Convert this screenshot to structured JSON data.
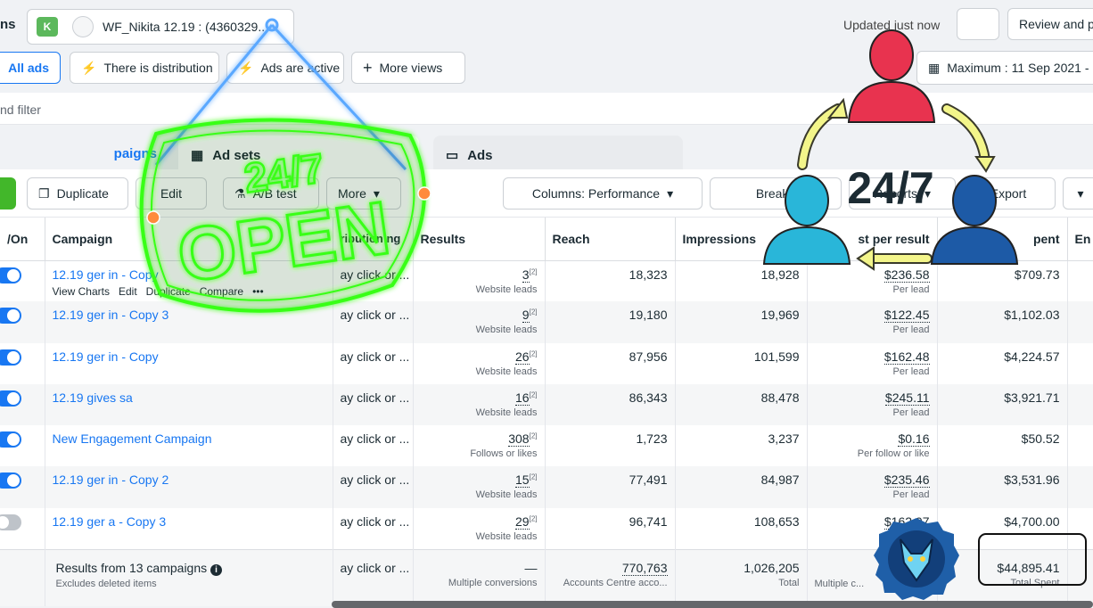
{
  "header": {
    "title_fragment": "ns",
    "account_badge": "K",
    "account_name": "WF_Nikita 12.19 : (4360329...",
    "updated": "Updated just now",
    "review": "Review and p"
  },
  "filters": {
    "all_ads": "All ads",
    "distribution": "There is distribution",
    "active": "Ads are active",
    "more_views": "More views",
    "date": "Maximum : 11 Sep 2021 -"
  },
  "filterbar": {
    "placeholder": "nd filter"
  },
  "tabs": {
    "campaigns": "paigns",
    "adsets": "Ad sets",
    "ads": "Ads"
  },
  "toolbar": {
    "duplicate": "Duplicate",
    "edit": "Edit",
    "ab_test": "A/B test",
    "more": "More",
    "columns": "Columns: Performance",
    "breakdown": "Breakd",
    "report": "Reports",
    "export": "Export"
  },
  "table": {
    "headers": {
      "toggle": "/On",
      "campaign": "Campaign",
      "attribution": "ribution ng",
      "results": "Results",
      "reach": "Reach",
      "impressions": "Impressions",
      "cost": "st per result",
      "spent": "pent",
      "end": "En"
    },
    "row_actions": [
      "View Charts",
      "Edit",
      "Duplicate",
      "Compare",
      "•••"
    ],
    "rows": [
      {
        "name": "12.19 ger in - Copy",
        "attr": "ay click or ...",
        "results": "3",
        "results_sub": "Website leads",
        "reach": "18,323",
        "impressions": "18,928",
        "cost": "$236.58",
        "cost_sub": "Per lead",
        "spent": "$709.73",
        "on": true
      },
      {
        "name": "12.19 ger in - Copy 3",
        "attr": "ay click or ...",
        "results": "9",
        "results_sub": "Website leads",
        "reach": "19,180",
        "impressions": "19,969",
        "cost": "$122.45",
        "cost_sub": "Per lead",
        "spent": "$1,102.03",
        "on": true
      },
      {
        "name": "12.19 ger in - Copy",
        "attr": "ay click or ...",
        "results": "26",
        "results_sub": "Website leads",
        "reach": "87,956",
        "impressions": "101,599",
        "cost": "$162.48",
        "cost_sub": "Per lead",
        "spent": "$4,224.57",
        "on": true
      },
      {
        "name": "12.19 gives sa",
        "attr": "ay click or ...",
        "results": "16",
        "results_sub": "Website leads",
        "reach": "86,343",
        "impressions": "88,478",
        "cost": "$245.11",
        "cost_sub": "Per lead",
        "spent": "$3,921.71",
        "on": true
      },
      {
        "name": "New Engagement Campaign",
        "attr": "ay click or ...",
        "results": "308",
        "results_sub": "Follows or likes",
        "reach": "1,723",
        "impressions": "3,237",
        "cost": "$0.16",
        "cost_sub": "Per follow or like",
        "spent": "$50.52",
        "on": true
      },
      {
        "name": "12.19 ger in - Copy 2",
        "attr": "ay click or ...",
        "results": "15",
        "results_sub": "Website leads",
        "reach": "77,491",
        "impressions": "84,987",
        "cost": "$235.46",
        "cost_sub": "Per lead",
        "spent": "$3,531.96",
        "on": true
      },
      {
        "name": "12.19 ger a - Copy 3",
        "attr": "ay click or ...",
        "results": "29",
        "results_sub": "Website leads",
        "reach": "96,741",
        "impressions": "108,653",
        "cost": "$162.07",
        "cost_sub": "Per lead",
        "spent": "$4,700.00",
        "on": false
      }
    ],
    "summary": {
      "title": "Results from 13 campaigns",
      "sub": "Excludes deleted items",
      "attr": "ay click or ...",
      "results": "—",
      "results_sub": "Multiple conversions",
      "reach": "770,763",
      "reach_sub": "Accounts Centre acco...",
      "impressions": "1,026,205",
      "impressions_sub": "Total",
      "cost_sub": "Multiple c...",
      "spent": "$44,895.41",
      "spent_sub": "Total Spent"
    }
  },
  "overlay": {
    "open_top": "24/7",
    "open_word": "OPEN",
    "cycle_text": "24/7"
  },
  "colors": {
    "accent": "#1877f2",
    "neon": "#39ff14",
    "red_person": "#e8334f",
    "cyan_person": "#29b6d9",
    "blue_person": "#1d5aa6",
    "arrow": "#f3f58a"
  }
}
